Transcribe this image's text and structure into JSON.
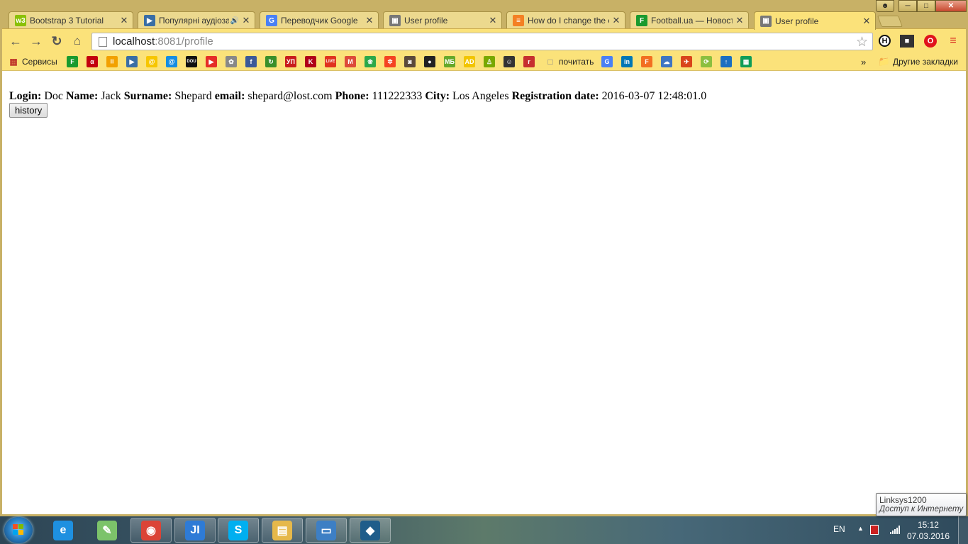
{
  "browser": {
    "tabs": [
      {
        "title": "Bootstrap 3 Tutorial",
        "favicon": "w3schools-icon",
        "color": "#8ac007",
        "glyph": "w3"
      },
      {
        "title": "Популярні аудіозапис",
        "favicon": "play-icon",
        "color": "#3a6ea5",
        "glyph": "▶",
        "audio": true
      },
      {
        "title": "Переводчик Google",
        "favicon": "google-translate-icon",
        "color": "#4a80f5",
        "glyph": "G"
      },
      {
        "title": "User profile",
        "favicon": "page-image-icon",
        "color": "#777777",
        "glyph": "▣"
      },
      {
        "title": "How do I change the c",
        "favicon": "stackoverflow-icon",
        "color": "#f48024",
        "glyph": "≡"
      },
      {
        "title": "Football.ua — Новост",
        "favicon": "football-ua-icon",
        "color": "#1a9a2e",
        "glyph": "F"
      },
      {
        "title": "User profile",
        "favicon": "page-image-icon",
        "color": "#777777",
        "glyph": "▣",
        "active": true
      }
    ],
    "address": {
      "host": "localhost",
      "rest": ":8081/profile"
    },
    "bookmarks": {
      "apps_label": "Сервисы",
      "icons": [
        {
          "name": "football-ua-bookmark-icon",
          "color": "#1a9a2e",
          "glyph": "F"
        },
        {
          "name": "last-fm-bookmark-icon",
          "color": "#c3000d",
          "glyph": "α"
        },
        {
          "name": "barcode-bookmark-icon",
          "color": "#f2a100",
          "glyph": "|||"
        },
        {
          "name": "play-bookmark-icon",
          "color": "#3a6ea5",
          "glyph": "▶"
        },
        {
          "name": "mail-yellow-bookmark-icon",
          "color": "#f7c600",
          "glyph": "@"
        },
        {
          "name": "mail-ru-bookmark-icon",
          "color": "#168de2",
          "glyph": "@"
        },
        {
          "name": "dou-bookmark-icon",
          "color": "#111111",
          "glyph": "DOU"
        },
        {
          "name": "youtube-bookmark-icon",
          "color": "#e52d27",
          "glyph": "▶"
        },
        {
          "name": "film-reel-bookmark-icon",
          "color": "#888888",
          "glyph": "✿"
        },
        {
          "name": "facebook-bookmark-icon",
          "color": "#3b5998",
          "glyph": "f"
        },
        {
          "name": "refresh-green-bookmark-icon",
          "color": "#3a8f2a",
          "glyph": "↻"
        },
        {
          "name": "yii-bookmark-icon",
          "color": "#c81c1c",
          "glyph": "УП"
        },
        {
          "name": "k-bookmark-icon",
          "color": "#b00018",
          "glyph": "K"
        },
        {
          "name": "live-bookmark-icon",
          "color": "#e0321e",
          "glyph": "LIVE"
        },
        {
          "name": "gmail-bookmark-icon",
          "color": "#dd4b39",
          "glyph": "M"
        },
        {
          "name": "paw-bookmark-icon",
          "color": "#2aa84a",
          "glyph": "❀"
        },
        {
          "name": "joomla-bookmark-icon",
          "color": "#f44321",
          "glyph": "✲"
        },
        {
          "name": "instagram-bookmark-icon",
          "color": "#5b4a3b",
          "glyph": "◙"
        },
        {
          "name": "github-bookmark-icon",
          "color": "#222222",
          "glyph": "●"
        },
        {
          "name": "mb-bookmark-icon",
          "color": "#66a82a",
          "glyph": "МБ"
        },
        {
          "name": "ad-bookmark-icon",
          "color": "#f2c500",
          "glyph": "AD"
        },
        {
          "name": "person-bookmark-icon",
          "color": "#78a800",
          "glyph": "♙"
        },
        {
          "name": "avatar-bookmark-icon",
          "color": "#333333",
          "glyph": "☺"
        },
        {
          "name": "r-bookmark-icon",
          "color": "#c62f2f",
          "glyph": "r"
        }
      ],
      "read_label": "почитать",
      "icons2": [
        {
          "name": "translate-bookmark-icon",
          "color": "#4a80f5",
          "glyph": "G"
        },
        {
          "name": "linkedin-bookmark-icon",
          "color": "#0077b5",
          "glyph": "in"
        },
        {
          "name": "f-orange-bookmark-icon",
          "color": "#f26f21",
          "glyph": "F"
        },
        {
          "name": "cloud-bookmark-icon",
          "color": "#3f75c2",
          "glyph": "☁"
        },
        {
          "name": "plane-bookmark-icon",
          "color": "#d9441a",
          "glyph": "✈"
        },
        {
          "name": "sync-bookmark-icon",
          "color": "#8cbf3f",
          "glyph": "⟳"
        },
        {
          "name": "arrow-up-bookmark-icon",
          "color": "#1b6fc1",
          "glyph": "↑"
        },
        {
          "name": "sheets-bookmark-icon",
          "color": "#0f9d58",
          "glyph": "▦"
        }
      ],
      "more": "»",
      "other_label": "Другие закладки"
    }
  },
  "profile": {
    "login_label": "Login:",
    "login": "Doc",
    "name_label": "Name:",
    "name": "Jack",
    "surname_label": "Surname:",
    "surname": "Shepard",
    "email_label": "email:",
    "email": "shepard@lost.com",
    "phone_label": "Phone:",
    "phone": "111222333",
    "city_label": "City:",
    "city": "Los Angeles",
    "regdate_label": "Registration date:",
    "regdate": "2016-03-07 12:48:01.0",
    "history_button": "history"
  },
  "taskbar": {
    "apps": [
      {
        "name": "internet-explorer-taskbar-button",
        "color": "#1e90e0",
        "glyph": "e",
        "open": false
      },
      {
        "name": "notepad-taskbar-button",
        "color": "#7cc36a",
        "glyph": "✎",
        "open": false
      },
      {
        "name": "chrome-taskbar-button",
        "color": "#db4437",
        "glyph": "◉",
        "open": true
      },
      {
        "name": "intellij-taskbar-button",
        "color": "#2e7bd6",
        "glyph": "JI",
        "open": true
      },
      {
        "name": "skype-taskbar-button",
        "color": "#00aff0",
        "glyph": "S",
        "open": true
      },
      {
        "name": "explorer-taskbar-button",
        "color": "#e6b84a",
        "glyph": "▤",
        "open": true
      },
      {
        "name": "image-viewer-taskbar-button",
        "color": "#3d7fc4",
        "glyph": "▭",
        "open": true
      },
      {
        "name": "mysql-workbench-taskbar-button",
        "color": "#1f5d8a",
        "glyph": "◆",
        "open": true
      }
    ],
    "lang": "EN",
    "time": "15:12",
    "date": "07.03.2016",
    "tooltip": {
      "network": "Linksys1200",
      "status": "Доступ к Интернету"
    }
  }
}
